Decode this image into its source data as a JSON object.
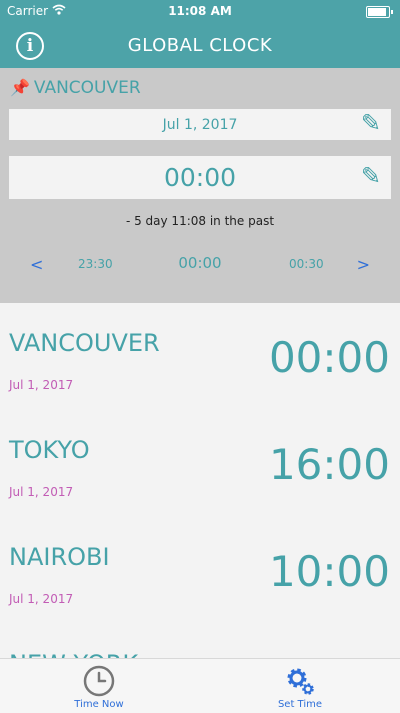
{
  "status_bar": {
    "carrier": "Carrier",
    "wifi_icon": "wifi-icon",
    "time": "11:08 AM",
    "battery_level": 0.9
  },
  "nav": {
    "title": "GLOBAL CLOCK",
    "info_label": "i"
  },
  "editor": {
    "location_icon": "pushpin-icon",
    "location": "VANCOUVER",
    "date": "Jul 1, 2017",
    "time": "00:00",
    "edit_icon": "pencil-icon",
    "past_note": "- 5 day 11:08 in the past",
    "stepper": {
      "prev_arrow": "<",
      "prev_time": "23:30",
      "current_time": "00:00",
      "next_time": "00:30",
      "next_arrow": ">"
    }
  },
  "clocks": [
    {
      "city": "VANCOUVER",
      "date": "Jul 1, 2017",
      "time": "00:00"
    },
    {
      "city": "TOKYO",
      "date": "Jul 1, 2017",
      "time": "16:00"
    },
    {
      "city": "NAIROBI",
      "date": "Jul 1, 2017",
      "time": "10:00"
    },
    {
      "city": "NEW YORK",
      "date": "",
      "time": ""
    }
  ],
  "tabs": [
    {
      "label": "Time Now",
      "icon": "clock-icon"
    },
    {
      "label": "Set Time",
      "icon": "gears-icon"
    }
  ],
  "colors": {
    "accent": "#4da3a8",
    "teal_text": "#46a2a8",
    "date_pink": "#c25cb5",
    "link_blue": "#2f6fd8",
    "panel_gray": "#c9c9c9"
  }
}
